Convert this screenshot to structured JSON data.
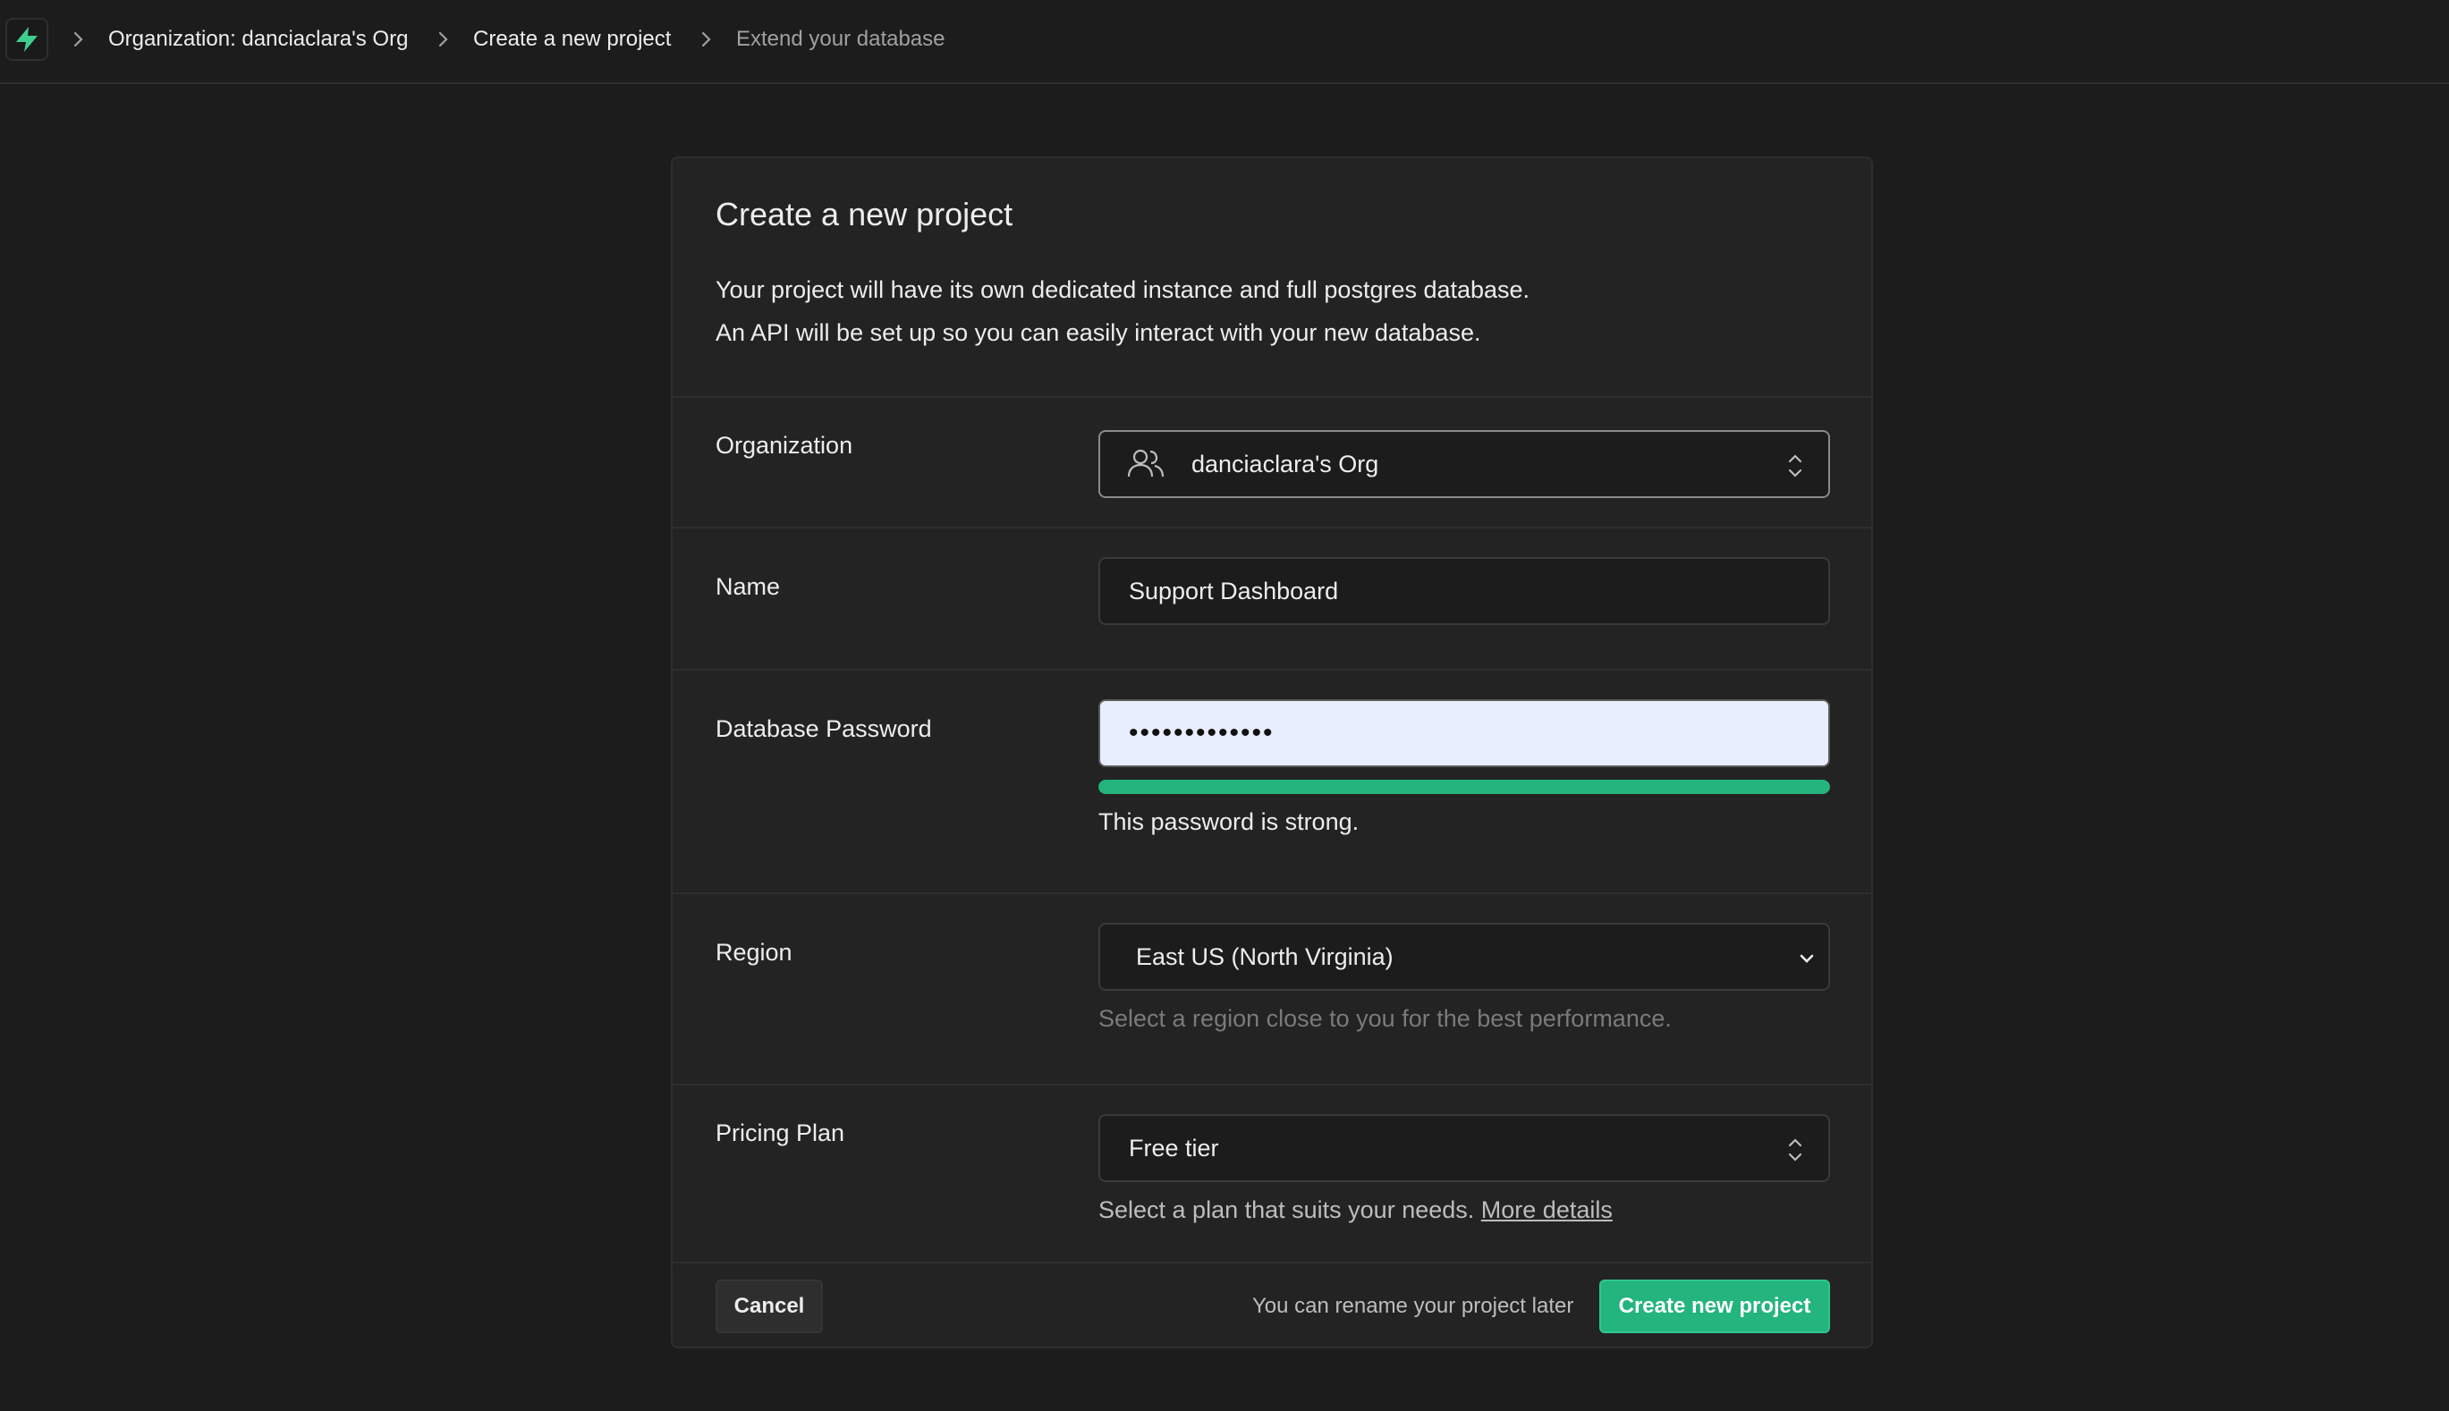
{
  "breadcrumb": {
    "items": [
      {
        "label": "Organization: danciaclara's Org"
      },
      {
        "label": "Create a new project"
      },
      {
        "label": "Extend your database"
      }
    ]
  },
  "card": {
    "title": "Create a new project",
    "description_line1": "Your project will have its own dedicated instance and full postgres database.",
    "description_line2": "An API will be set up so you can easily interact with your new database."
  },
  "organization": {
    "label": "Organization",
    "value": "danciaclara's Org",
    "icon": "users-icon"
  },
  "name": {
    "label": "Name",
    "value": "Support Dashboard"
  },
  "password": {
    "label": "Database Password",
    "value": "•••••••••••••",
    "strength_fraction": 1.0,
    "strength_color": "#24b47e",
    "strength_text": "This password is strong."
  },
  "region": {
    "label": "Region",
    "value": "East US (North Virginia)",
    "helper": "Select a region close to you for the best performance."
  },
  "pricing": {
    "label": "Pricing Plan",
    "value": "Free tier",
    "helper": "Select a plan that suits your needs.",
    "link": "More details"
  },
  "footer": {
    "cancel_label": "Cancel",
    "note": "You can rename your project later",
    "create_label": "Create new project"
  },
  "colors": {
    "background": "#1c1c1c",
    "card": "#232323",
    "accent": "#24b47e",
    "password_field_bg": "#e8eefe"
  }
}
